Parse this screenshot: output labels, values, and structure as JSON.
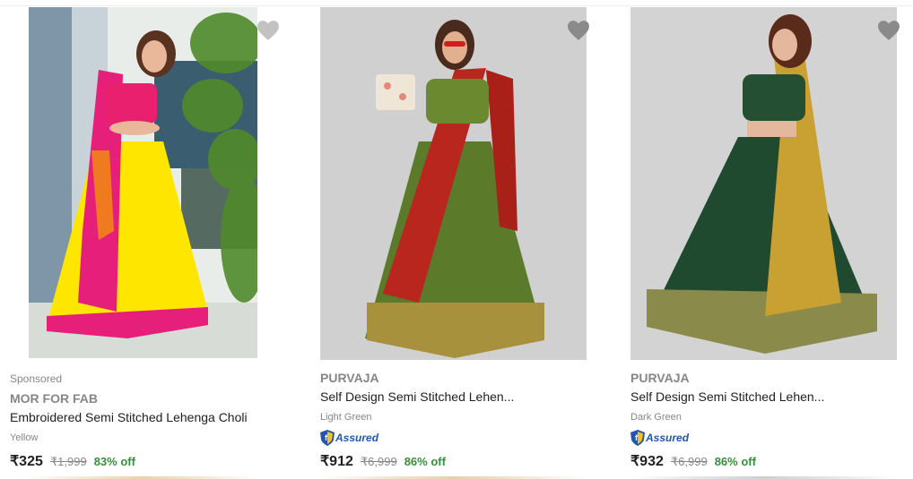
{
  "products": [
    {
      "sponsored_label": "Sponsored",
      "brand": "MOR FOR FAB",
      "title": "Embroidered Semi Stitched Lehenga Choli",
      "variant": "Yellow",
      "price": "₹325",
      "mrp": "₹1,999",
      "discount": "83% off",
      "assured": false,
      "image_desc": "woman in pink and yellow lehenga choli",
      "colors": {
        "primary": "#ffe600",
        "secondary": "#e6207a"
      }
    },
    {
      "brand": "PURVAJA",
      "title": "Self Design Semi Stitched Lehen...",
      "variant": "Light Green",
      "assured_label": "Assured",
      "price": "₹912",
      "mrp": "₹6,999",
      "discount": "86% off",
      "assured": true,
      "image_desc": "woman in green lehenga with red dupatta",
      "colors": {
        "primary": "#5b7a2a",
        "secondary": "#b8261e"
      }
    },
    {
      "brand": "PURVAJA",
      "title": "Self Design Semi Stitched Lehen...",
      "variant": "Dark Green",
      "assured_label": "Assured",
      "price": "₹932",
      "mrp": "₹6,999",
      "discount": "86% off",
      "assured": true,
      "image_desc": "woman in dark green lehenga with gold dupatta",
      "colors": {
        "primary": "#1f4a30",
        "secondary": "#c9a032"
      }
    }
  ],
  "icons": {
    "wishlist": "heart-icon",
    "assured": "assured-badge-icon"
  },
  "theme": {
    "discount_color": "#388e3c",
    "assured_color": "#2455a8",
    "muted_text": "#878787"
  }
}
